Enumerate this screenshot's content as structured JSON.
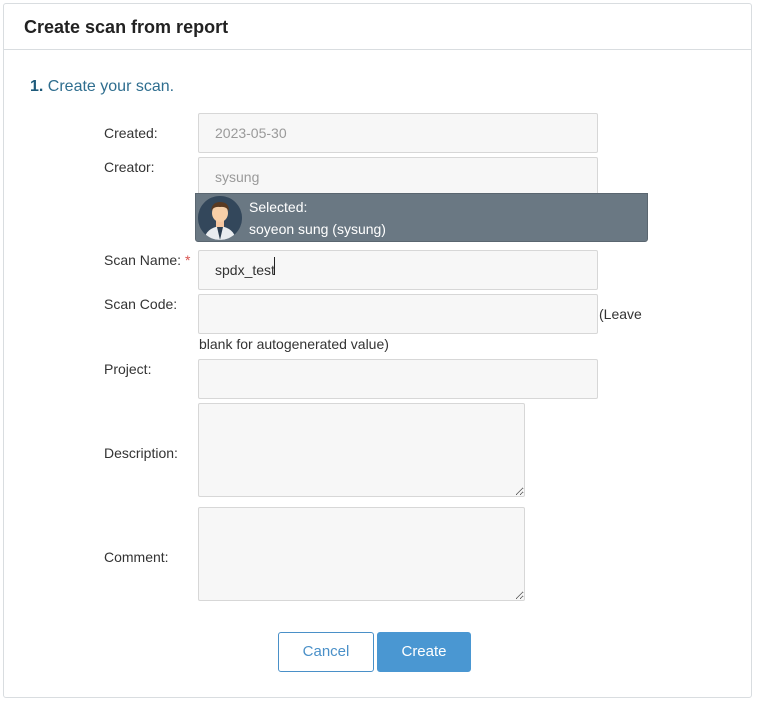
{
  "header": {
    "title": "Create scan from report"
  },
  "step": {
    "number": "1.",
    "text": "Create your scan."
  },
  "form": {
    "created_label": "Created:",
    "created_value": "2023-05-30",
    "creator_label": "Creator:",
    "creator_value": "sysung",
    "selected_title": "Selected:",
    "selected_user": "soyeon sung (sysung)",
    "scan_name_label": "Scan Name:",
    "scan_name_required": "*",
    "scan_name_value": "spdx_test",
    "scan_code_label": "Scan Code:",
    "scan_code_value": "",
    "scan_code_hint_1": "(Leave",
    "scan_code_hint_2": "blank for autogenerated value)",
    "project_label": "Project:",
    "project_value": "",
    "description_label": "Description:",
    "description_value": "",
    "comment_label": "Comment:",
    "comment_value": ""
  },
  "buttons": {
    "cancel": "Cancel",
    "create": "Create"
  },
  "colors": {
    "accent": "#4a97d2",
    "step_text": "#2f6e8f",
    "selected_bg": "#6a7883",
    "required": "#d9534f"
  }
}
